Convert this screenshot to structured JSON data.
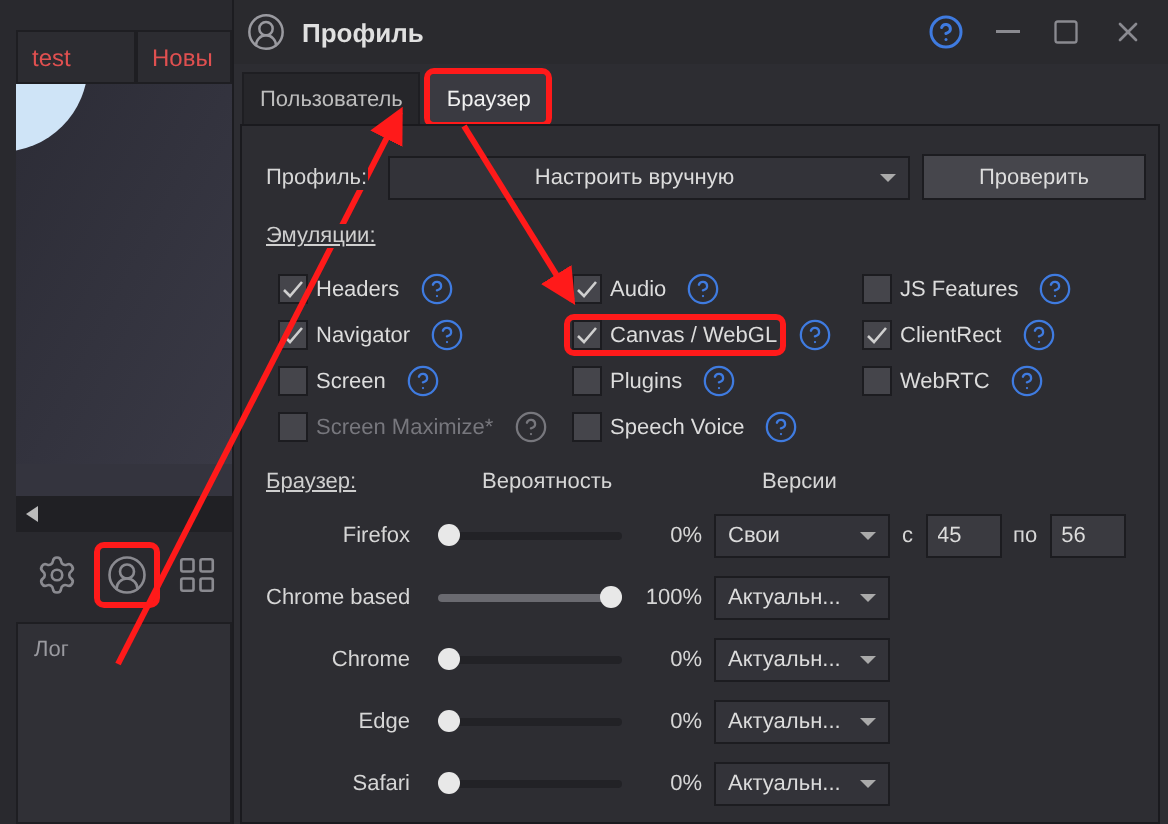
{
  "background_app": {
    "tabs": [
      {
        "label": "test"
      },
      {
        "label": "Новы"
      }
    ],
    "toolbar": [
      {
        "kind": "settings",
        "highlighted": false
      },
      {
        "kind": "profile",
        "highlighted": true
      },
      {
        "kind": "grid",
        "highlighted": false
      }
    ],
    "log_panel": {
      "title": "Лог"
    }
  },
  "dialog": {
    "title": "Профиль"
  },
  "tabs": [
    {
      "label": "Пользователь",
      "selected": false,
      "highlighted": false
    },
    {
      "label": "Браузер",
      "selected": true,
      "highlighted": true
    }
  ],
  "profile": {
    "label": "Профиль:",
    "value": "Настроить вручную",
    "button": "Проверить"
  },
  "emulations": {
    "title": "Эмуляции:",
    "items": [
      {
        "label": "Headers",
        "checked": true,
        "disabled": false,
        "highlighted": false
      },
      {
        "label": "Audio",
        "checked": true,
        "disabled": false,
        "highlighted": false
      },
      {
        "label": "JS Features",
        "checked": false,
        "disabled": false,
        "highlighted": false
      },
      {
        "label": "Navigator",
        "checked": true,
        "disabled": false,
        "highlighted": false
      },
      {
        "label": "Canvas / WebGL",
        "checked": true,
        "disabled": false,
        "highlighted": true
      },
      {
        "label": "ClientRect",
        "checked": true,
        "disabled": false,
        "highlighted": false
      },
      {
        "label": "Screen",
        "checked": false,
        "disabled": false,
        "highlighted": false
      },
      {
        "label": "Plugins",
        "checked": false,
        "disabled": false,
        "highlighted": false
      },
      {
        "label": "WebRTC",
        "checked": false,
        "disabled": false,
        "highlighted": false
      },
      {
        "label": "Screen Maximize*",
        "checked": false,
        "disabled": true,
        "highlighted": false
      },
      {
        "label": "Speech Voice",
        "checked": false,
        "disabled": false,
        "highlighted": false
      }
    ]
  },
  "browsers": {
    "title": "Браузер:",
    "probability_header": "Вероятность",
    "versions_header": "Версии",
    "rows": [
      {
        "name": "Firefox",
        "level": 0,
        "reading": "0%",
        "version": "Свои",
        "range": {
          "from_label": "с",
          "from": "45",
          "to_label": "по",
          "to": "56"
        }
      },
      {
        "name": "Chrome based",
        "level": 1,
        "reading": "100%",
        "version": "Актуальн..."
      },
      {
        "name": "Chrome",
        "level": 0,
        "reading": "0%",
        "version": "Актуальн..."
      },
      {
        "name": "Edge",
        "level": 0,
        "reading": "0%",
        "version": "Актуальн..."
      },
      {
        "name": "Safari",
        "level": 0,
        "reading": "0%",
        "version": "Актуальн..."
      }
    ]
  }
}
